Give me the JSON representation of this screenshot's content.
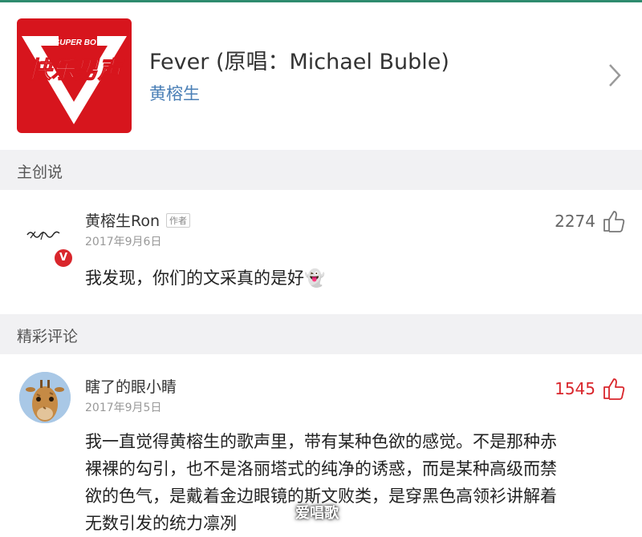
{
  "song": {
    "title": "Fever (原唱：Michael Buble)",
    "artist": "黄榕生",
    "cover_logo_text": "快乐男声",
    "cover_badge_text": "SUPER BOY"
  },
  "sections": {
    "creator_label": "主创说",
    "featured_label": "精彩评论"
  },
  "creator_comment": {
    "name": "黄榕生Ron",
    "author_tag": "作者",
    "date": "2017年9月6日",
    "likes": "2274",
    "text": "我发现，你们的文采真的是好👻",
    "badge": "V"
  },
  "featured_comment": {
    "name": "瞎了的眼小睛",
    "date": "2017年9月5日",
    "likes": "1545",
    "text_lines": [
      "我一直觉得黄榕生的歌声里，带有某种色欲的感觉。不是那种赤",
      "裸裸的勾引，也不是洛丽塔式的纯净的诱惑，而是某种高级而禁",
      "欲的色气，是戴着金边眼镜的斯文败类，是穿黑色高领衫讲解着",
      "无数引发的统力凛冽"
    ]
  },
  "watermark": "爱唱歌",
  "colors": {
    "accent_red": "#d9262c",
    "link_blue": "#4a7fb6",
    "section_bg": "#f1f1f3"
  }
}
